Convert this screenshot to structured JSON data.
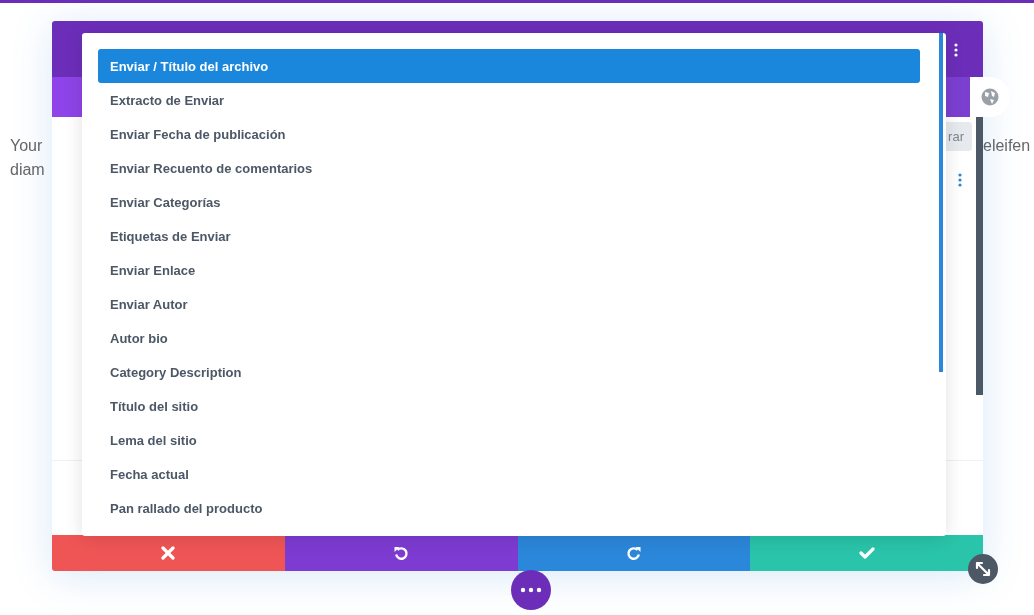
{
  "page": {
    "paragraph_lines": [
      "Your",
      "diam"
    ],
    "right_fragment": "eleifen"
  },
  "modal": {
    "filter_button": "rar",
    "footer": [
      {
        "kind": "cancel"
      },
      {
        "kind": "undo"
      },
      {
        "kind": "redo"
      },
      {
        "kind": "save"
      }
    ]
  },
  "dropdown": {
    "items": [
      {
        "label": "Enviar / Título del archivo",
        "selected": true
      },
      {
        "label": "Extracto de Enviar",
        "selected": false
      },
      {
        "label": "Enviar Fecha de publicación",
        "selected": false
      },
      {
        "label": "Enviar Recuento de comentarios",
        "selected": false
      },
      {
        "label": "Enviar Categorías",
        "selected": false
      },
      {
        "label": "Etiquetas de Enviar",
        "selected": false
      },
      {
        "label": "Enviar Enlace",
        "selected": false
      },
      {
        "label": "Enviar Autor",
        "selected": false
      },
      {
        "label": "Autor bio",
        "selected": false
      },
      {
        "label": "Category Description",
        "selected": false
      },
      {
        "label": "Título del sitio",
        "selected": false
      },
      {
        "label": "Lema del sitio",
        "selected": false
      },
      {
        "label": "Fecha actual",
        "selected": false
      },
      {
        "label": "Pan rallado del producto",
        "selected": false
      }
    ]
  }
}
